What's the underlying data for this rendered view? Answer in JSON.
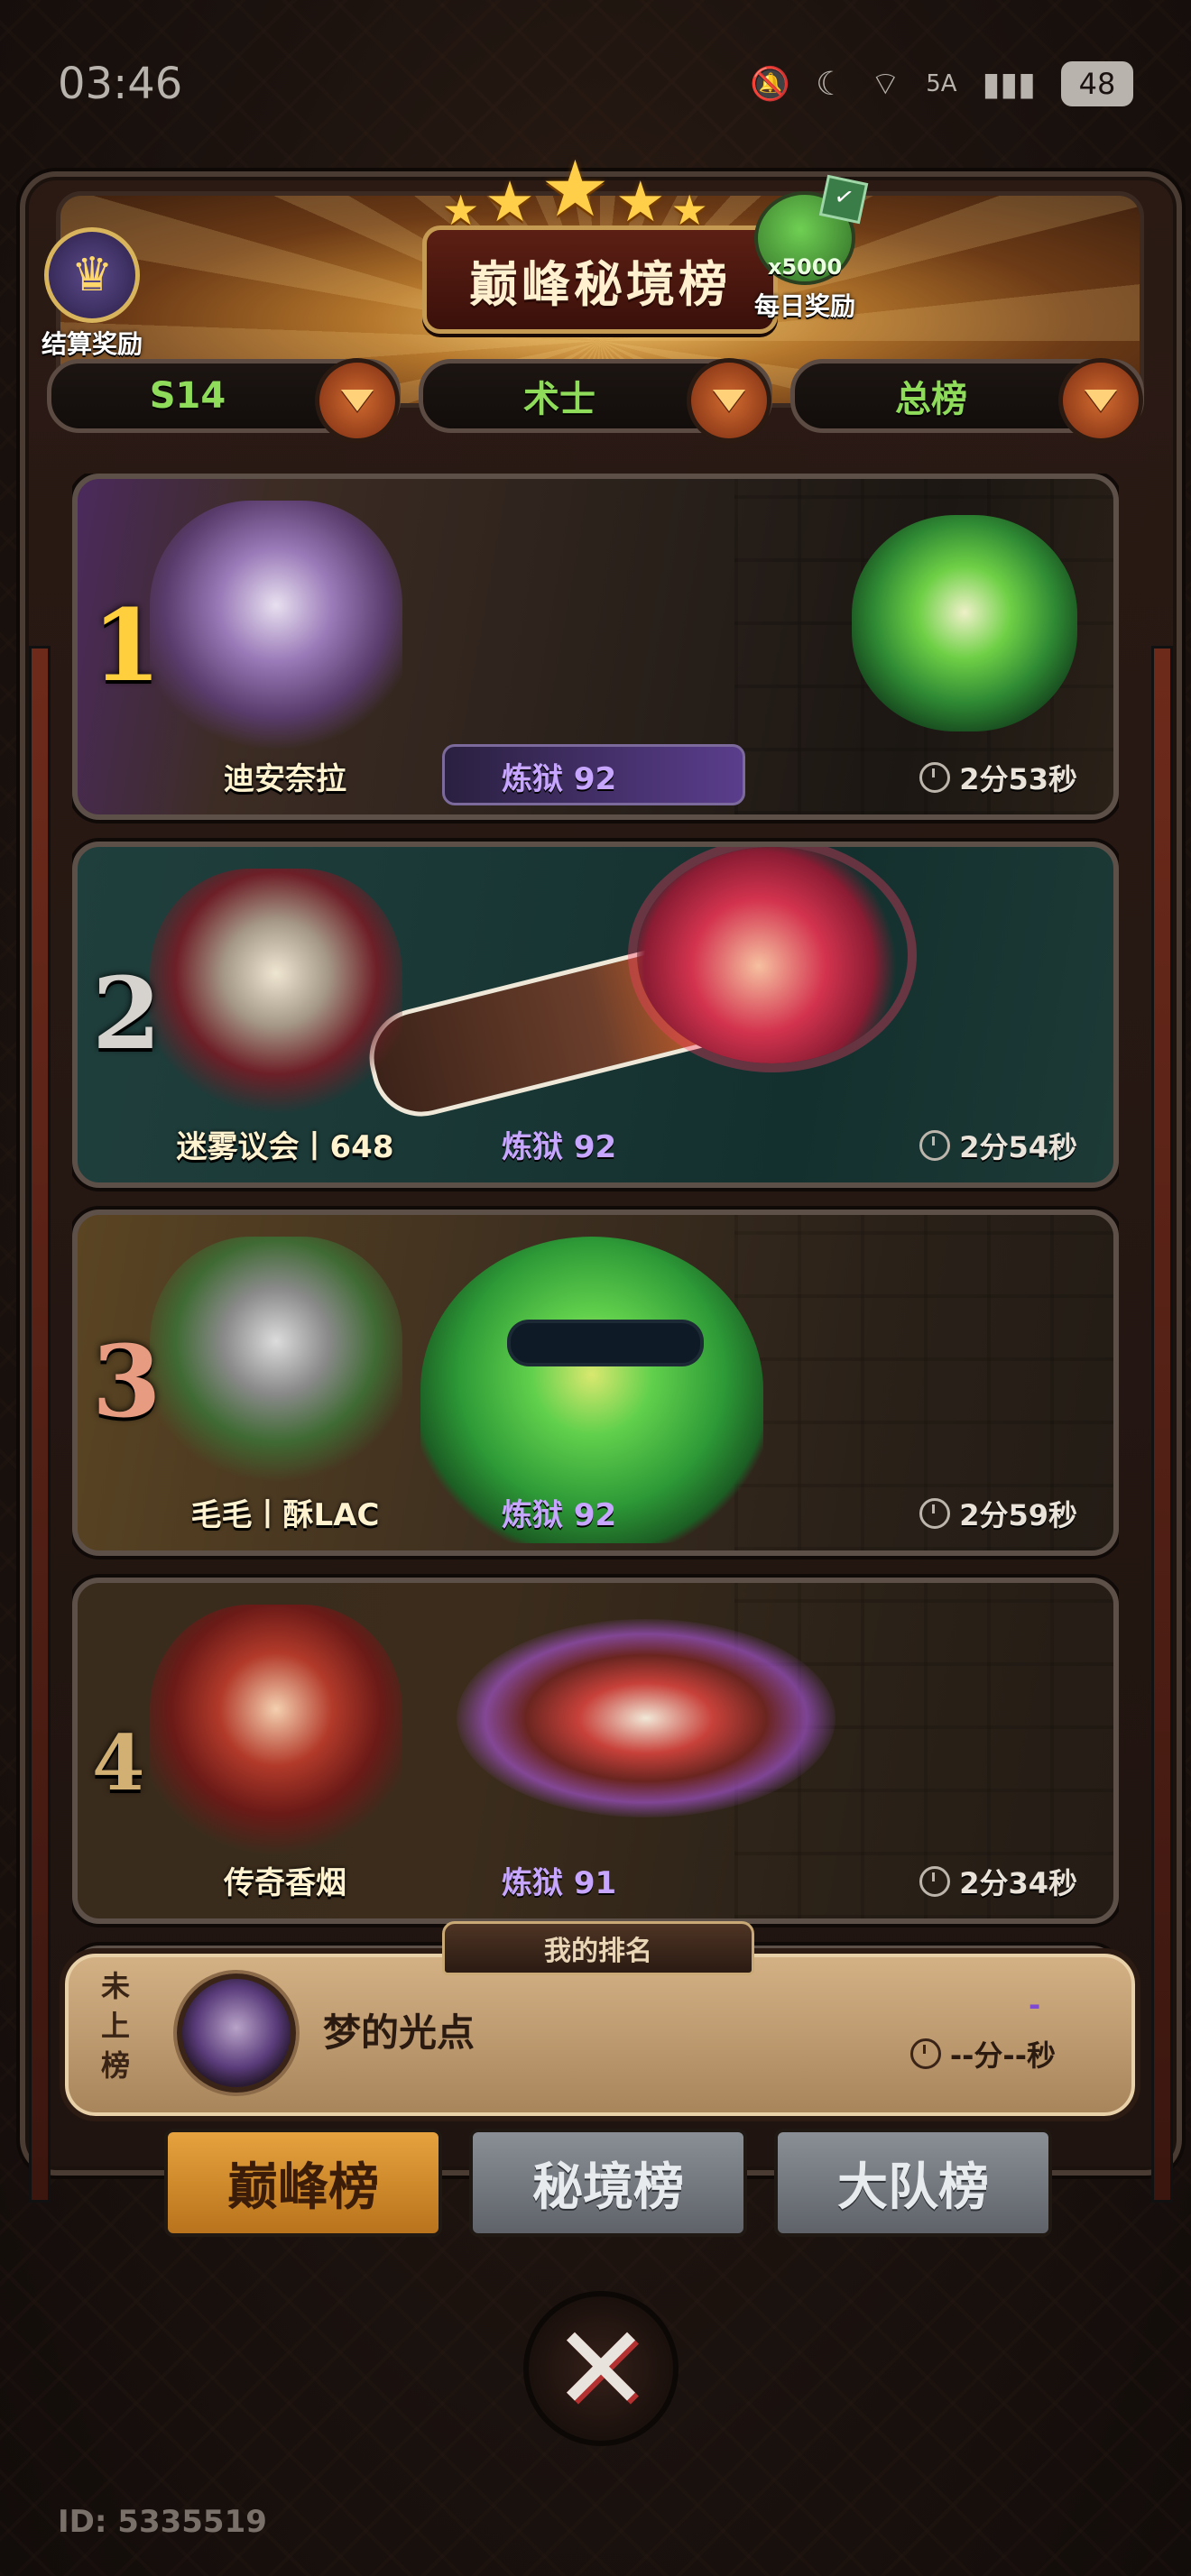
{
  "status_bar": {
    "time": "03:46",
    "network": "5A",
    "battery": "48"
  },
  "header": {
    "title": "巅峰秘境榜",
    "settlement_reward_label": "结算奖励",
    "daily_reward_label": "每日奖励",
    "daily_reward_count": "x5000"
  },
  "filters": [
    {
      "label": "S14"
    },
    {
      "label": "术士"
    },
    {
      "label": "总榜"
    }
  ],
  "ranking": [
    {
      "rank": "1",
      "name": "迪安奈拉",
      "level": "炼狱 92",
      "time": "2分53秒"
    },
    {
      "rank": "2",
      "name": "迷雾议会丨648",
      "level": "炼狱 92",
      "time": "2分54秒"
    },
    {
      "rank": "3",
      "name": "毛毛丨酥LAC",
      "level": "炼狱 92",
      "time": "2分59秒"
    },
    {
      "rank": "4",
      "name": "传奇香烟",
      "level": "炼狱 91",
      "time": "2分34秒"
    }
  ],
  "my_rank": {
    "tab_label": "我的排名",
    "status": "未上榜",
    "name": "梦的光点",
    "score": "-",
    "time": "--分--秒"
  },
  "tabs": [
    {
      "label": "巅峰榜",
      "active": true
    },
    {
      "label": "秘境榜",
      "active": false
    },
    {
      "label": "大队榜",
      "active": false
    }
  ],
  "footer": {
    "user_id": "ID: 5335519"
  },
  "colors": {
    "filter_text": "#8fdc5a",
    "level_text": "#c7a6ff",
    "active_tab": "#e6a23e",
    "inactive_tab": "#8a8f96"
  }
}
